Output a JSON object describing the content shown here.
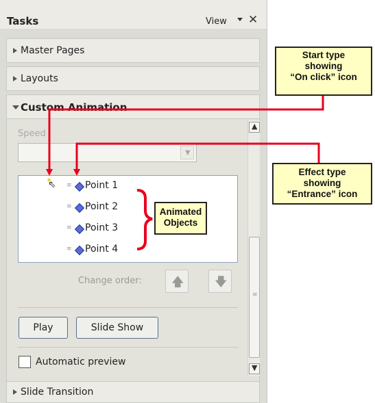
{
  "panel": {
    "title": "Tasks",
    "view_label": "View",
    "close_glyph": "✕"
  },
  "sections": {
    "master_pages": "Master Pages",
    "layouts": "Layouts",
    "custom_animation": "Custom Animation",
    "slide_transition": "Slide Transition"
  },
  "custom_animation": {
    "speed_label": "Speed",
    "speed_value": "",
    "items": [
      {
        "label": "Point 1"
      },
      {
        "label": "Point 2"
      },
      {
        "label": "Point 3"
      },
      {
        "label": "Point 4"
      }
    ],
    "change_order_label": "Change order:",
    "play_label": "Play",
    "slide_show_label": "Slide Show",
    "automatic_preview_label": "Automatic preview",
    "automatic_preview_checked": false
  },
  "callouts": {
    "start_type": [
      "Start type",
      "showing",
      "“On click” icon"
    ],
    "effect_type": [
      "Effect type",
      "showing",
      "“Entrance” icon"
    ],
    "animated_objects": [
      "Animated",
      "Objects"
    ]
  },
  "icons": {
    "move_up": "up-arrow-icon",
    "move_down": "down-arrow-icon",
    "entrance": "diamond-icon",
    "on_click": "mouse-pointer-icon"
  },
  "colors": {
    "annotation_red": "#e8001c",
    "callout_fill": "#ffffc4",
    "entrance_diamond": "#5a6dd6"
  }
}
